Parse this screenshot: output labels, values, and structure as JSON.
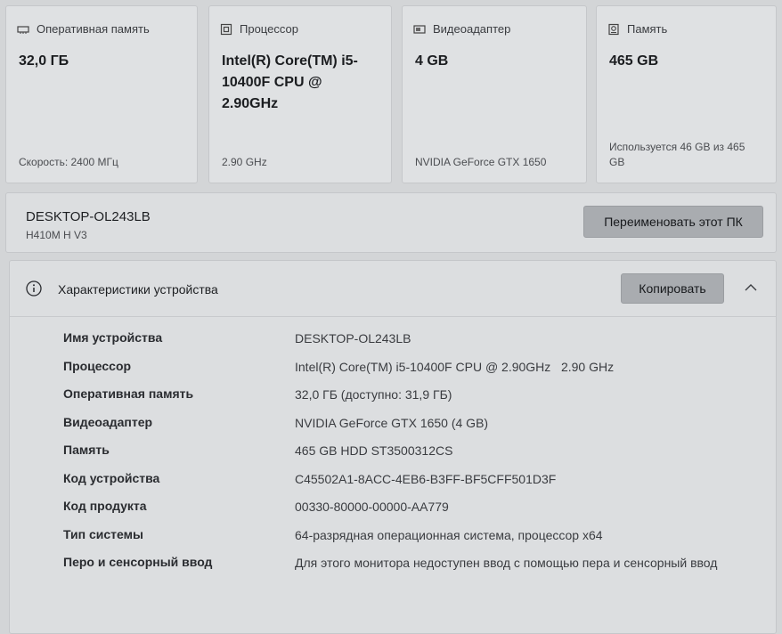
{
  "cards": [
    {
      "title": "Оперативная память",
      "icon": "memory-icon",
      "value": "32,0 ГБ",
      "sub": "Скорость: 2400 МГц"
    },
    {
      "title": "Процессор",
      "icon": "processor-icon",
      "value": "Intel(R) Core(TM) i5-10400F CPU @ 2.90GHz",
      "sub": "2.90 GHz"
    },
    {
      "title": "Видеоадаптер",
      "icon": "gpu-icon",
      "value": "4 GB",
      "sub": "NVIDIA GeForce GTX 1650"
    },
    {
      "title": "Память",
      "icon": "storage-icon",
      "value": "465 GB",
      "sub": "Используется 46 GB из 465 GB"
    }
  ],
  "device": {
    "name": "DESKTOP-OL243LB",
    "model": "H410M H V3",
    "rename_label": "Переименовать этот ПК"
  },
  "specs": {
    "title": "Характеристики устройства",
    "copy_label": "Копировать",
    "rows": [
      {
        "label": "Имя устройства",
        "value": "DESKTOP-OL243LB"
      },
      {
        "label": "Процессор",
        "value": "Intel(R) Core(TM) i5-10400F CPU @ 2.90GHz   2.90 GHz"
      },
      {
        "label": "Оперативная память",
        "value": "32,0 ГБ (доступно: 31,9 ГБ)"
      },
      {
        "label": "Видеоадаптер",
        "value": "NVIDIA GeForce GTX 1650 (4 GB)"
      },
      {
        "label": "Память",
        "value": "465 GB HDD ST3500312CS"
      },
      {
        "label": "Код устройства",
        "value": "C45502A1-8ACC-4EB6-B3FF-BF5CFF501D3F"
      },
      {
        "label": "Код продукта",
        "value": "00330-80000-00000-AA779"
      },
      {
        "label": "Тип системы",
        "value": "64-разрядная операционная система, процессор x64"
      },
      {
        "label": "Перо и сенсорный ввод",
        "value": "Для этого монитора недоступен ввод с помощью пера и сенсорный ввод"
      }
    ]
  },
  "colors": {
    "background": "#d3d5d7",
    "card": "#dfe1e3",
    "button": "#a9acb0"
  }
}
